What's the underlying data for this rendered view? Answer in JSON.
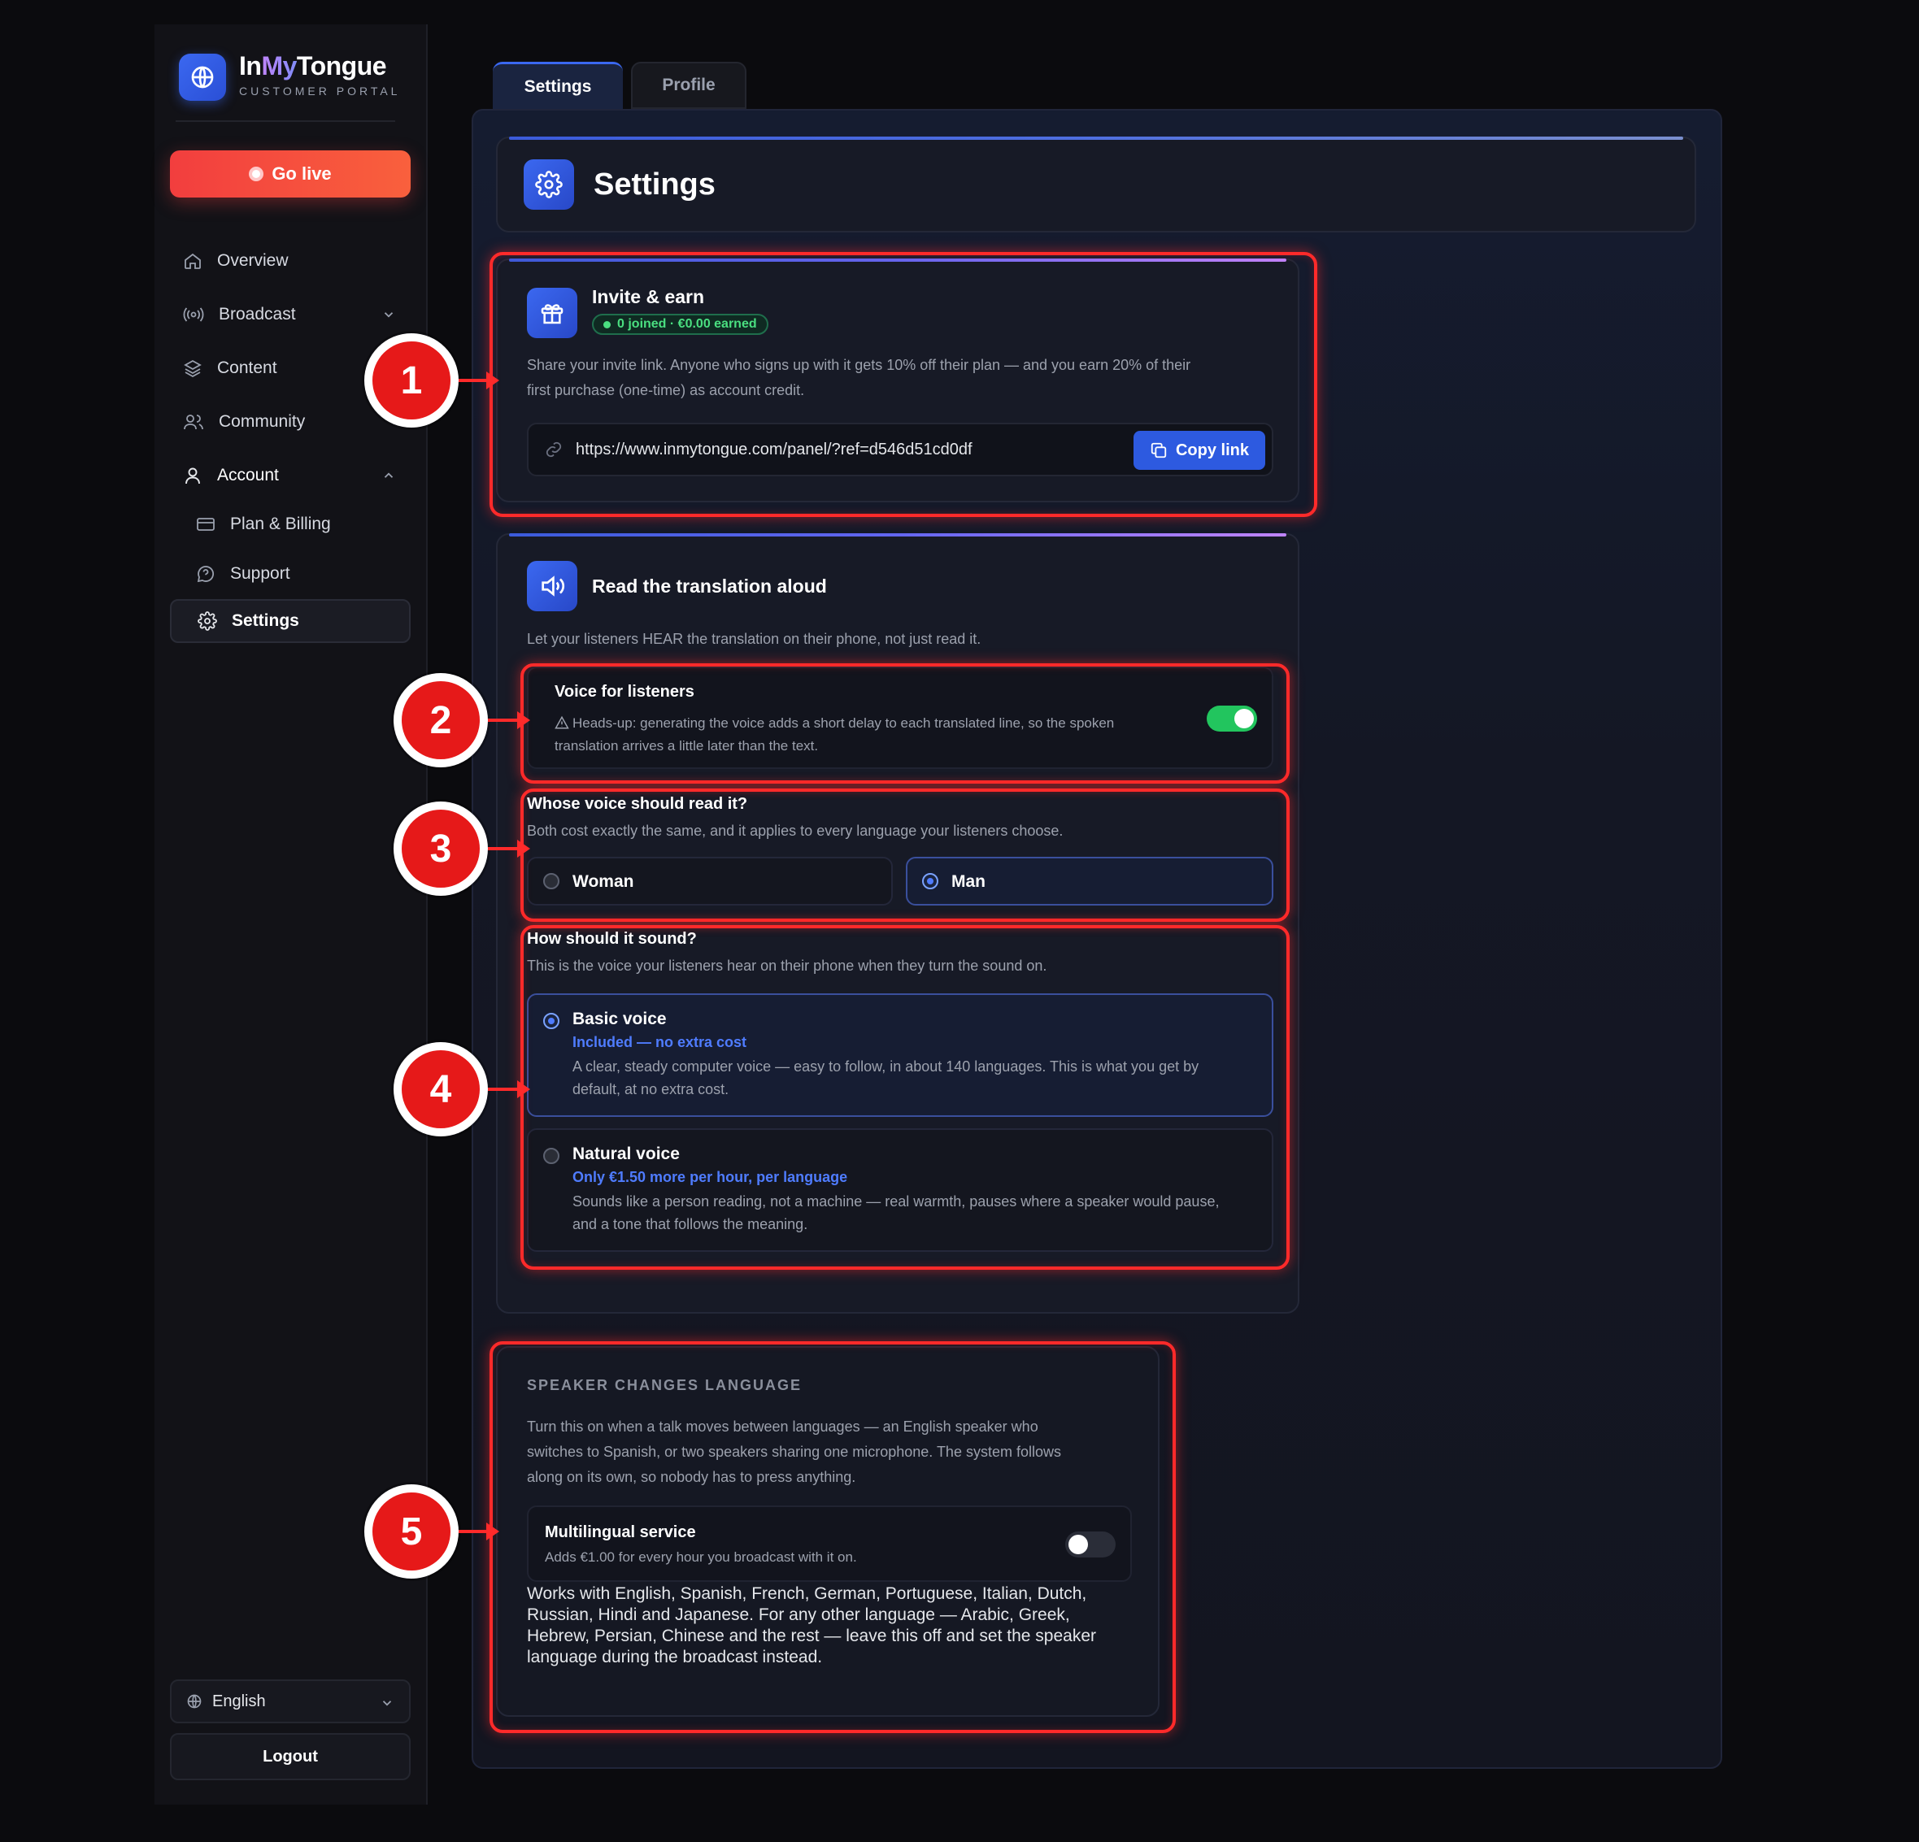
{
  "app": {
    "name_pre": "In",
    "name_hl": "My",
    "name_post": "Tongue",
    "subtitle": "CUSTOMER PORTAL"
  },
  "sidebar": {
    "go_live": "Go live",
    "items": [
      {
        "label": "Overview",
        "icon": "home-icon"
      },
      {
        "label": "Broadcast",
        "icon": "broadcast-icon"
      },
      {
        "label": "Content",
        "icon": "layers-icon"
      },
      {
        "label": "Community",
        "icon": "users-icon"
      },
      {
        "label": "Account",
        "icon": "user-icon"
      },
      {
        "label": "Plan & Billing",
        "icon": "credit-card-icon"
      },
      {
        "label": "Support",
        "icon": "chat-icon"
      },
      {
        "label": "Settings",
        "icon": "gear-icon"
      }
    ],
    "language": "English",
    "logout": "Logout"
  },
  "tabs": [
    {
      "label": "Settings"
    },
    {
      "label": "Profile"
    }
  ],
  "header": {
    "title": "Settings"
  },
  "invite": {
    "title": "Invite & earn",
    "badge": "0 joined · €0.00 earned",
    "desc_1": "Share your invite link. Anyone who signs up with it gets 10% off their plan — and you earn 20% of their",
    "desc_2": "first purchase (one-time) as account credit.",
    "url": "https://www.inmytongue.com/panel/?ref=d546d51cd0df",
    "copy": "Copy link"
  },
  "tts": {
    "title": "Read the translation aloud",
    "desc": "Let your listeners HEAR the translation on their phone, not just read it.",
    "voice_toggle": {
      "label": "Voice for listeners",
      "note_1": "Heads-up: generating the voice adds a short delay to each translated line, so the spoken",
      "note_2": "translation arrives a little later than the text.",
      "enabled": true
    },
    "whose": {
      "question": "Whose voice should read it?",
      "sub": "Both cost exactly the same, and it applies to every language your listeners choose.",
      "options": [
        {
          "label": "Woman"
        },
        {
          "label": "Man"
        }
      ],
      "selected": "Man"
    },
    "sound": {
      "question": "How should it sound?",
      "sub": "This is the voice your listeners hear on their phone when they turn the sound on.",
      "options": [
        {
          "name": "Basic voice",
          "price": "Included — no extra cost",
          "desc_1": "A clear, steady computer voice — easy to follow, in about 140 languages. This is what you get by",
          "desc_2": "default, at no extra cost."
        },
        {
          "name": "Natural voice",
          "price": "Only €1.50 more per hour, per language",
          "desc_1": "Sounds like a person reading, not a machine — real warmth, pauses where a speaker would pause,",
          "desc_2": "and a tone that follows the meaning."
        }
      ],
      "selected": "Basic voice"
    }
  },
  "multilingual": {
    "heading": "SPEAKER CHANGES LANGUAGE",
    "desc_1": "Turn this on when a talk moves between languages — an English speaker who",
    "desc_2": "switches to Spanish, or two speakers sharing one microphone. The system follows",
    "desc_3": "along on its own, so nobody has to press anything.",
    "toggle_label": "Multilingual service",
    "toggle_sub": "Adds €1.00 for every hour you broadcast with it on.",
    "enabled": false,
    "note_1": "Works with English, Spanish, French, German, Portuguese, Italian, Dutch,",
    "note_2": "Russian, Hindi and Japanese. For any other language — Arabic, Greek,",
    "note_3": "Hebrew, Persian, Chinese and the rest — leave this off and set the speaker",
    "note_4": "language during the broadcast instead."
  },
  "annotations": [
    "1",
    "2",
    "3",
    "4",
    "5"
  ],
  "colors": {
    "accent": "#3b68f0",
    "live": "#f23e3e",
    "success": "#22c55e",
    "highlight": "#ff2a2a"
  }
}
